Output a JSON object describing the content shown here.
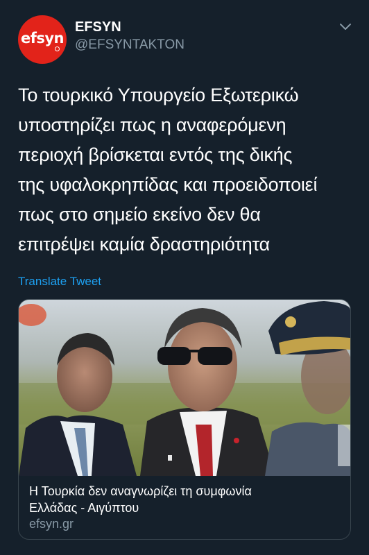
{
  "account": {
    "avatar_text": "efsyn",
    "display_name": "EFSYN",
    "handle": "@EFSYNTAKTON"
  },
  "tweet": {
    "text": "Το τουρκικό Υπουργείο Εξωτερικώ\nυποστηρίζει πως η αναφερόμενη\nπεριοχή βρίσκεται εντός της δικής\nτης υφαλοκρηπίδας και προειδοποιεί\nπως στο σημείο εκείνο δεν θα\nεπιτρέψει καμία δραστηριότητα",
    "translate_label": "Translate Tweet"
  },
  "card": {
    "title": "Η Τουρκία δεν αναγνωρίζει τη συμφωνία\nΕλλάδας - Αιγύπτου",
    "domain": "efsyn.gr"
  },
  "icons": {
    "more": "chevron-down-icon"
  },
  "colors": {
    "background": "#15202b",
    "brand_red": "#e2231a",
    "link_blue": "#1da1f2",
    "secondary_text": "#8899a6",
    "border": "#38444d"
  }
}
